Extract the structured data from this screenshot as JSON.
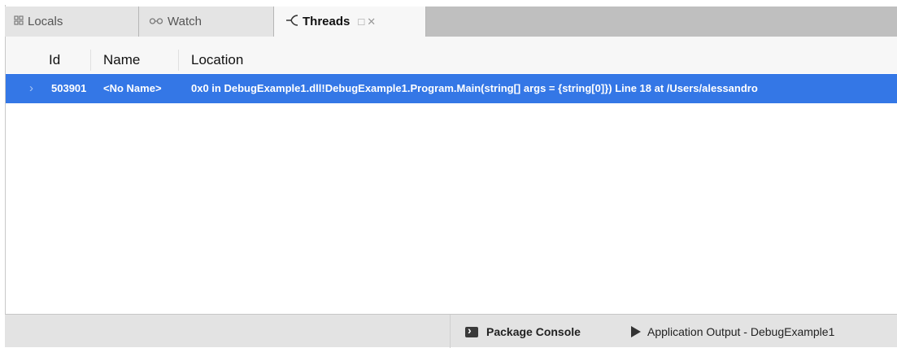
{
  "tabs": [
    {
      "label": "Locals",
      "icon": "locals-grid-icon"
    },
    {
      "label": "Watch",
      "icon": "glasses-icon"
    },
    {
      "label": "Threads",
      "icon": "threads-fork-icon",
      "active": true
    }
  ],
  "threads": {
    "columns": [
      "Id",
      "Name",
      "Location"
    ],
    "rows": [
      {
        "id": "503901",
        "name": "<No Name>",
        "location": "0x0 in DebugExample1.dll!DebugExample1.Program.Main(string[] args = {string[0]}) Line 18 at /Users/alessandro",
        "selected": true
      }
    ]
  },
  "statusbar": {
    "package_console": "Package Console",
    "application_output": "Application Output - DebugExample1"
  },
  "colors": {
    "selection": "#3477e6",
    "tabbar": "#bfbfbf",
    "statusbar": "#e3e3e3"
  }
}
